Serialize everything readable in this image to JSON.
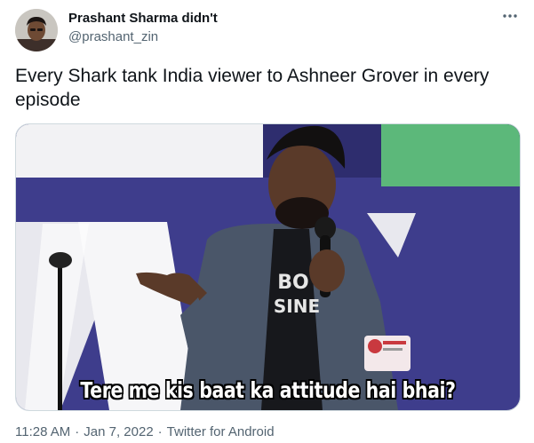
{
  "author": {
    "name": "Prashant Sharma didn't",
    "handle": "@prashant_zin",
    "avatar_icon": "user-avatar"
  },
  "more_icon": "ellipsis-icon",
  "tweet": {
    "text": "Every Shark tank India viewer to Ashneer Grover in every episode"
  },
  "media": {
    "caption": "Tere me kis baat ka attitude hai bhai?",
    "shirt_text_line1": "BO",
    "shirt_text_line2": "SINE"
  },
  "meta": {
    "time": "11:28 AM",
    "date": "Jan 7, 2022",
    "source": "Twitter for Android",
    "separator": "·"
  },
  "colors": {
    "stage_blue": "#3e3d8c",
    "green_panel": "#5cb87a",
    "caption_text": "#ffffff",
    "secondary_text": "#536471"
  }
}
